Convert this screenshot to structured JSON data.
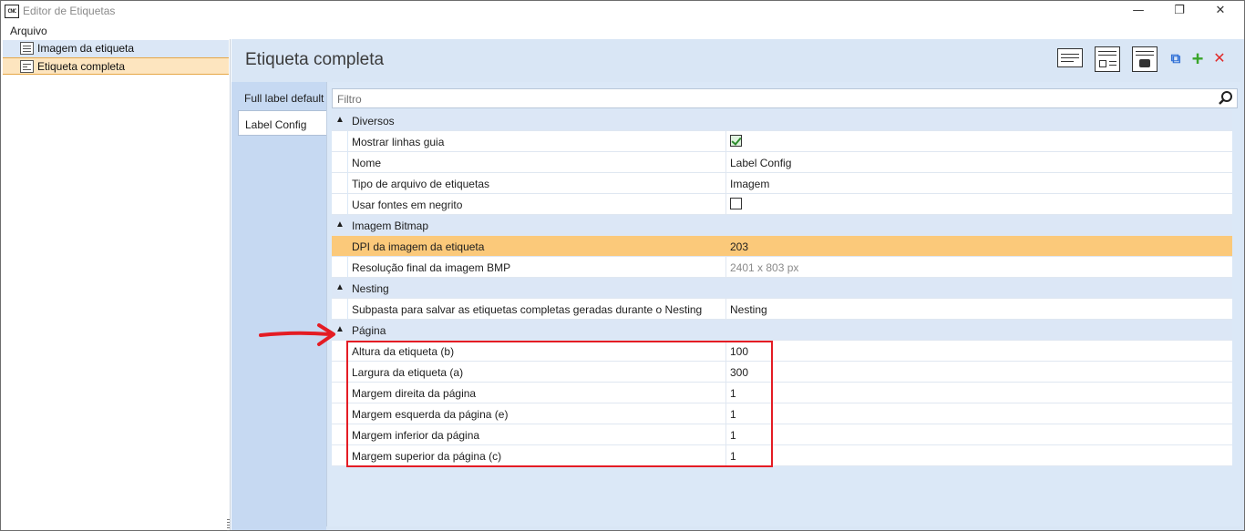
{
  "window": {
    "app_icon_text": "CNC",
    "title": "Editor de Etiquetas",
    "controls": {
      "minimize": "—",
      "restore": "❐",
      "close": "✕"
    }
  },
  "menu": {
    "file": "Arquivo"
  },
  "tree": {
    "items": [
      {
        "label": "Imagem da etiqueta",
        "icon": "label-image-icon",
        "state": "hover"
      },
      {
        "label": "Etiqueta completa",
        "icon": "full-label-icon",
        "state": "selected"
      }
    ]
  },
  "page": {
    "title": "Etiqueta completa"
  },
  "toolbar": {
    "buttons": [
      {
        "name": "add-text-field",
        "icon": "text-lines-icon"
      },
      {
        "name": "add-image-field",
        "icon": "image-frame-icon"
      },
      {
        "name": "add-photo-field",
        "icon": "camera-frame-icon"
      },
      {
        "name": "duplicate",
        "icon": "copy-icon",
        "color": "#2f6fd6"
      },
      {
        "name": "add",
        "icon": "plus-icon",
        "color": "#3aa52a"
      },
      {
        "name": "delete",
        "icon": "x-icon",
        "color": "#e02b2b"
      }
    ]
  },
  "tabs": [
    {
      "label": "Full label default",
      "active": false
    },
    {
      "label": "Label Config",
      "active": true
    }
  ],
  "search": {
    "placeholder": "Filtro"
  },
  "sections": [
    {
      "title": "Diversos",
      "properties": [
        {
          "name": "Mostrar linhas guia",
          "type": "checkbox",
          "checked": true
        },
        {
          "name": "Nome",
          "value": "Label Config"
        },
        {
          "name": "Tipo de arquivo de etiquetas",
          "value": "Imagem"
        },
        {
          "name": "Usar fontes em negrito",
          "type": "checkbox",
          "checked": false
        }
      ]
    },
    {
      "title": "Imagem Bitmap",
      "properties": [
        {
          "name": "DPI da imagem da etiqueta",
          "value": "203",
          "highlighted": true
        },
        {
          "name": "Resolução final da imagem BMP",
          "value": "2401 x 803 px",
          "readonly": true
        }
      ]
    },
    {
      "title": "Nesting",
      "properties": [
        {
          "name": "Subpasta para salvar as etiquetas completas geradas durante o Nesting",
          "value": "Nesting"
        }
      ]
    },
    {
      "title": "Página",
      "properties": [
        {
          "name": "Altura da etiqueta (b)",
          "value": "100"
        },
        {
          "name": "Largura da etiqueta (a)",
          "value": "300"
        },
        {
          "name": "Margem direita da página",
          "value": "1"
        },
        {
          "name": "Margem esquerda da página (e)",
          "value": "1"
        },
        {
          "name": "Margem inferior da página",
          "value": "1"
        },
        {
          "name": "Margem superior da página (c)",
          "value": "1"
        }
      ]
    }
  ],
  "annotations": {
    "arrow_color": "#e41c24",
    "box_color": "#e41c24"
  }
}
